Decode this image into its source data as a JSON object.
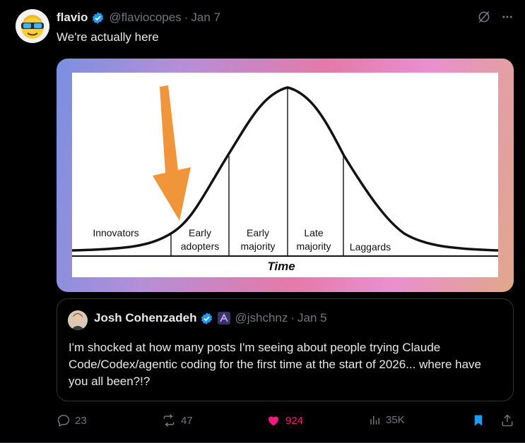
{
  "post": {
    "author_name": "flavio",
    "handle": "@flaviocopes",
    "separator": "·",
    "date": "Jan 7",
    "text": "We're actually here",
    "menu_icon": "more-icon",
    "grok_icon": "grok-icon"
  },
  "media": {
    "labels": {
      "innovators": "Innovators",
      "early_adopters_1": "Early",
      "early_adopters_2": "adopters",
      "early_majority_1": "Early",
      "early_majority_2": "majority",
      "late_majority_1": "Late",
      "late_majority_2": "majority",
      "laggards": "Laggards",
      "time": "Time"
    },
    "arrow_color": "#f0953a"
  },
  "quote": {
    "author_name": "Josh Cohenzadeh",
    "handle": "@jshchnz",
    "separator": "·",
    "date": "Jan 5",
    "text": "I'm shocked at how many posts I'm seeing about people trying Claude Code/Codex/agentic coding for the first time at the start of 2026... where have you all been?!?"
  },
  "actions": {
    "replies": "23",
    "reposts": "47",
    "likes": "924",
    "views": "35K"
  },
  "colors": {
    "verified": "#1d9bf0",
    "like": "#f91880",
    "bookmark": "#1d9bf0",
    "muted": "#71767b"
  }
}
